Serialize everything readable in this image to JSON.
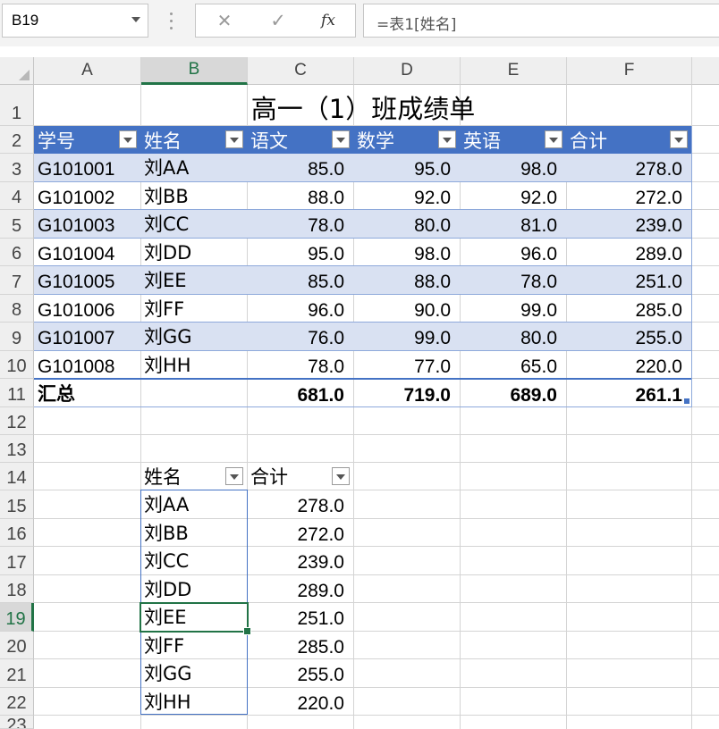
{
  "formula_bar": {
    "name_box": "B19",
    "cancel_symbol": "✕",
    "enter_symbol": "✓",
    "fx_label": "fx",
    "formula": "=表1[姓名]"
  },
  "columns": [
    "A",
    "B",
    "C",
    "D",
    "E",
    "F"
  ],
  "selected_column": "B",
  "rows": [
    "1",
    "2",
    "3",
    "4",
    "5",
    "6",
    "7",
    "8",
    "9",
    "10",
    "11",
    "12",
    "13",
    "14",
    "15",
    "16",
    "17",
    "18",
    "19",
    "20",
    "21",
    "22",
    "23"
  ],
  "selected_row": "19",
  "table1": {
    "title": "高一（1）班成绩单",
    "headers": [
      "学号",
      "姓名",
      "语文",
      "数学",
      "英语",
      "合计"
    ],
    "data": [
      [
        "G101001",
        "刘AA",
        "85.0",
        "95.0",
        "98.0",
        "278.0"
      ],
      [
        "G101002",
        "刘BB",
        "88.0",
        "92.0",
        "92.0",
        "272.0"
      ],
      [
        "G101003",
        "刘CC",
        "78.0",
        "80.0",
        "81.0",
        "239.0"
      ],
      [
        "G101004",
        "刘DD",
        "95.0",
        "98.0",
        "96.0",
        "289.0"
      ],
      [
        "G101005",
        "刘EE",
        "85.0",
        "88.0",
        "78.0",
        "251.0"
      ],
      [
        "G101006",
        "刘FF",
        "96.0",
        "90.0",
        "99.0",
        "285.0"
      ],
      [
        "G101007",
        "刘GG",
        "76.0",
        "99.0",
        "80.0",
        "255.0"
      ],
      [
        "G101008",
        "刘HH",
        "78.0",
        "77.0",
        "65.0",
        "220.0"
      ]
    ],
    "total": [
      "汇总",
      "",
      "681.0",
      "719.0",
      "689.0",
      "261.1"
    ]
  },
  "table2": {
    "headers": [
      "姓名",
      "合计"
    ],
    "data": [
      [
        "刘AA",
        "278.0"
      ],
      [
        "刘BB",
        "272.0"
      ],
      [
        "刘CC",
        "239.0"
      ],
      [
        "刘DD",
        "289.0"
      ],
      [
        "刘EE",
        "251.0"
      ],
      [
        "刘FF",
        "285.0"
      ],
      [
        "刘GG",
        "255.0"
      ],
      [
        "刘HH",
        "220.0"
      ]
    ]
  },
  "colors": {
    "accent": "#217346",
    "table_header": "#4472c4",
    "band": "#d9e1f2"
  }
}
